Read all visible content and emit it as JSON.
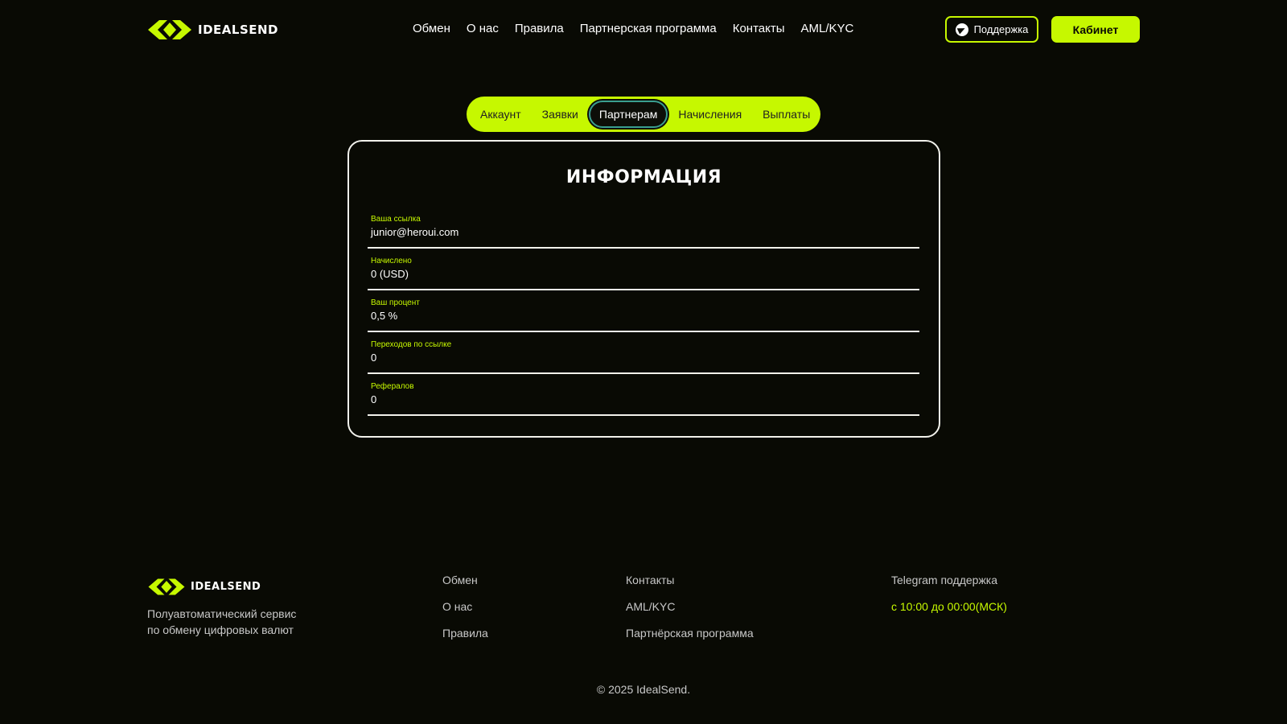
{
  "brand": {
    "name": "IDEALSEND",
    "accent_color": "#c6f800",
    "background_color": "#090a04"
  },
  "header": {
    "nav": [
      {
        "label": "Обмен"
      },
      {
        "label": "О нас"
      },
      {
        "label": "Правила"
      },
      {
        "label": "Партнерская программа"
      },
      {
        "label": "Контакты"
      },
      {
        "label": "AML/KYC"
      }
    ],
    "support_label": "Поддержка",
    "support_icon": "telegram-icon",
    "cabinet_label": "Кабинет"
  },
  "tabs": [
    {
      "label": "Аккаунт",
      "active": false
    },
    {
      "label": "Заявки",
      "active": false
    },
    {
      "label": "Партнерам",
      "active": true
    },
    {
      "label": "Начисления",
      "active": false
    },
    {
      "label": "Выплаты",
      "active": false
    }
  ],
  "info": {
    "title": "ИНФОРМАЦИЯ",
    "fields": [
      {
        "label": "Ваша ссылка",
        "value": "junior@heroui.com"
      },
      {
        "label": "Начислено",
        "value": "0 (USD)"
      },
      {
        "label": "Ваш процент",
        "value": "0,5 %"
      },
      {
        "label": "Переходов по ссылке",
        "value": "0"
      },
      {
        "label": "Рефералов",
        "value": "0"
      }
    ]
  },
  "footer": {
    "description": "Полуавтоматический сервис по обмену цифровых валют",
    "col1": [
      {
        "label": "Обмен"
      },
      {
        "label": "О нас"
      },
      {
        "label": "Правила"
      }
    ],
    "col2": [
      {
        "label": "Контакты"
      },
      {
        "label": "AML/KYC"
      },
      {
        "label": "Партнёрская программа"
      }
    ],
    "support_title": "Telegram поддержка",
    "support_hours": "с 10:00 до 00:00(МСК)",
    "copyright": "© 2025 IdealSend."
  }
}
